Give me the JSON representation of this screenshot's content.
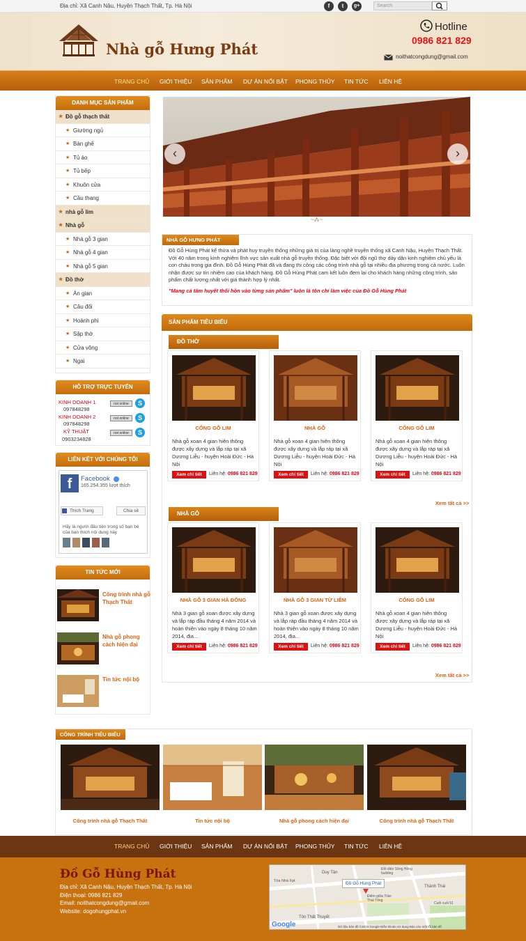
{
  "topbar": {
    "address": "Địa chỉ: Xã Canh Nậu, Huyện Thạch Thất, Tp. Hà Nội",
    "search_placeholder": "Search",
    "social": [
      "f",
      "t",
      "g+"
    ]
  },
  "header": {
    "brand": "Nhà gỗ Hưng Phát",
    "hotline_label": "Hotline",
    "phone": "0986 821 829",
    "email": "noithatcongdung@gmail.com"
  },
  "nav": {
    "items": [
      "TRANG CHỦ",
      "GIỚI THIỆU",
      "SẢN PHẨM",
      "DỰ ÁN NỔI BẬT",
      "PHONG THỦY",
      "TIN TỨC",
      "LIÊN HỆ"
    ]
  },
  "sidebar": {
    "catalog_title": "DANH MỤC SẢN PHẨM",
    "categories": [
      {
        "label": "Đồ gỗ thạch thất",
        "top": true
      },
      {
        "label": "Giường ngủ",
        "top": false
      },
      {
        "label": "Bàn ghế",
        "top": false
      },
      {
        "label": "Tủ áo",
        "top": false
      },
      {
        "label": "Tủ bếp",
        "top": false
      },
      {
        "label": "Khuôn cửa",
        "top": false
      },
      {
        "label": "Cầu thang",
        "top": false
      },
      {
        "label": "nhà gỗ lim",
        "top": true
      },
      {
        "label": "Nhà gỗ",
        "top": true
      },
      {
        "label": "Nhà gỗ 3 gian",
        "top": false
      },
      {
        "label": "Nhà gỗ 4 gian",
        "top": false
      },
      {
        "label": "Nhà gỗ 5 gian",
        "top": false
      },
      {
        "label": "Đồ thờ",
        "top": true
      },
      {
        "label": "Án gian",
        "top": false
      },
      {
        "label": "Câu đối",
        "top": false
      },
      {
        "label": "Hoành phi",
        "top": false
      },
      {
        "label": "Sập thờ",
        "top": false
      },
      {
        "label": "Cửa võng",
        "top": false
      },
      {
        "label": "Ngai",
        "top": false
      }
    ],
    "support_title": "HỖ TRỢ TRỰC TUYẾN",
    "support": [
      {
        "name": "KINH DOANH 1",
        "phone": "097848298"
      },
      {
        "name": "KINH DOANH 2",
        "phone": "097848298"
      },
      {
        "name": "KỸ THUẬT",
        "phone": "0903234828"
      }
    ],
    "online_badge": "not online",
    "links_title": "LIÊN KẾT VỚI CHÚNG TÔI",
    "facebook": {
      "name": "Facebook",
      "likes": "165.254.355 lượt thích",
      "like_btn": "Thích Trang",
      "share_btn": "Chia sẻ",
      "prompt": "Hãy là người đầu tiên trong số bạn bè của bạn thích nội dung này"
    },
    "news_title": "TIN TỨC MỚI",
    "news": [
      "Công trình nhà gỗ Thạch Thất",
      "Nhà gỗ phong cách hiện đại",
      "Tin tức nội bộ"
    ]
  },
  "intro": {
    "title": "NHÀ GỖ HƯNG PHÁT",
    "text": "Đồ Gỗ Hùng Phát kế thừa và phát huy truyền thống những giá trị của làng nghề truyền thống xã Canh Nậu, Huyện Thạch Thất. Với 40 năm trong kinh nghiệm lĩnh vực sản xuất nhà gỗ truyền thống. Đặc biệt với đội ngũ thợ dày dặn kinh nghiệm chủ yếu là con cháu trong gia đình. Đồ Gỗ Hùng Phát đã và đang thi công các công trình nhà gỗ tại nhiều địa phương trong cả nước. Luôn nhận được sự tín nhiệm cao của khách hàng. Đồ Gỗ Hùng Phát cam kết luôn đem lại cho khách hàng những công trình, sản phẩm chất lượng nhất với giá thành hợp lý nhất.",
    "quote": "\"Mang cả tâm huyết thổi hồn vào từng sản phẩm\" luôn là tôn chỉ làm việc của Đồ Gỗ Hùng Phát"
  },
  "products": {
    "title": "SẢN PHẨM TIÊU BIỂU",
    "contact_label": "Liên hệ:",
    "contact_phone": "0986 821 829",
    "detail_btn": "Xem chi tiết",
    "see_all": "Xem tất cả >>",
    "groups": [
      {
        "name": "ĐỒ THỜ",
        "items": [
          {
            "title": "CỔNG GỖ LIM",
            "desc": "Nhà gỗ xoan 4 gian hiên thông được xây dựng và lắp ráp tại xã Dương Liễu - huyện Hoài Đức - Hà Nội"
          },
          {
            "title": "NHÀ GỖ",
            "desc": "Nhà gỗ xoan 4 gian hiên thông được xây dựng và lắp ráp tại xã Dương Liễu - huyện Hoài Đức - Hà Nội"
          },
          {
            "title": "CỔNG GỖ LIM",
            "desc": "Nhà gỗ xoan 4 gian hiên thông được xây dựng và lắp ráp tại xã Dương Liễu - huyện Hoài Đức - Hà Nội"
          }
        ]
      },
      {
        "name": "NHÀ GỖ",
        "items": [
          {
            "title": "NHÀ GỖ 3 GIAN HÀ ĐÔNG",
            "desc": "Nhà 3 gian gỗ xoan được xây dựng và lắp ráp đầu tháng 4 năm 2014 và hoàn thiện vào ngày 8 tháng 10 năm 2014, địa..."
          },
          {
            "title": "NHÀ GỖ 3 GIAN TỪ LIÊM",
            "desc": "Nhà 3 gian gỗ xoan được xây dựng và lắp ráp đầu tháng 4 năm 2014 và hoàn thiện vào ngày 8 tháng 10 năm 2014, địa..."
          },
          {
            "title": "CỔNG GỖ LIM",
            "desc": "Nhà gỗ xoan 4 gian hiên thông được xây dựng và lắp ráp tại xã Dương Liễu - huyện Hoài Đức - Hà Nội"
          }
        ]
      }
    ]
  },
  "works": {
    "title": "CÔNG TRÌNH TIÊU BIỂU",
    "items": [
      "Công trình nhà gỗ Thạch Thất",
      "Tin tức nội bộ",
      "Nhà gỗ phong cách hiện đại",
      "Công trình nhà gỗ Thạch Thất"
    ]
  },
  "footer": {
    "name": "Đồ Gỗ Hùng Phát",
    "address": "Địa chỉ: Xã Canh Nậu, Huyện Thạch Thất, Tp. Hà Nội",
    "phone": "Điện thoại: 0986 821 829",
    "email": "Email: noithatcongdung@gmail.com",
    "website": "Website: dogohungphat.vn",
    "map": {
      "place": "Đồ Gỗ Hùng Phát",
      "google": "Google",
      "labels": [
        "Duy Tân",
        "Tòa Nhà Fpt",
        "Đối diện Sông Hồng building",
        "Thành Thái",
        "Cuối cuối 51",
        "Điểm giữa Trần Thái Tông",
        "Tôn Thất Thuyết"
      ],
      "footer_text": "Dữ liệu bản đồ ©2015 Google   Điều khoản sử dụng   Báo cáo một lỗi bản đồ"
    }
  },
  "colors": {
    "accent": "#c46c0c",
    "nav_bg": "#b5600a",
    "footer_bg": "#c8720f",
    "footnav_bg": "#6b3611",
    "link": "#e06010",
    "brand_text": "#7a3a12"
  }
}
